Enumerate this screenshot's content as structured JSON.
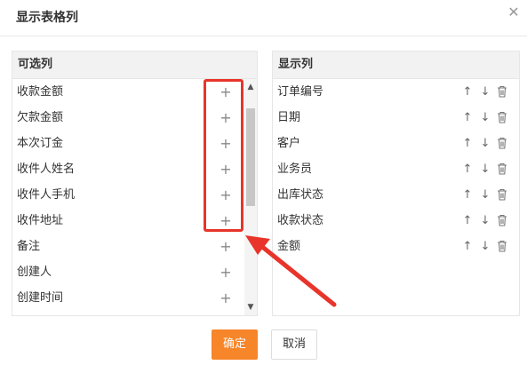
{
  "dialog": {
    "title": "显示表格列",
    "close_glyph": "✕"
  },
  "available": {
    "header": "可选列",
    "items": [
      "收款金额",
      "欠款金额",
      "本次订金",
      "收件人姓名",
      "收件人手机",
      "收件地址",
      "备注",
      "创建人",
      "创建时间"
    ],
    "add_glyph": "+"
  },
  "displayed": {
    "header": "显示列",
    "items": [
      "订单编号",
      "日期",
      "客户",
      "业务员",
      "出库状态",
      "收款状态",
      "金额"
    ],
    "up_glyph": "↑",
    "down_glyph": "↓"
  },
  "buttons": {
    "confirm": "确定",
    "cancel": "取消"
  },
  "colors": {
    "accent": "#f7852a",
    "annotation": "#e8342a"
  }
}
